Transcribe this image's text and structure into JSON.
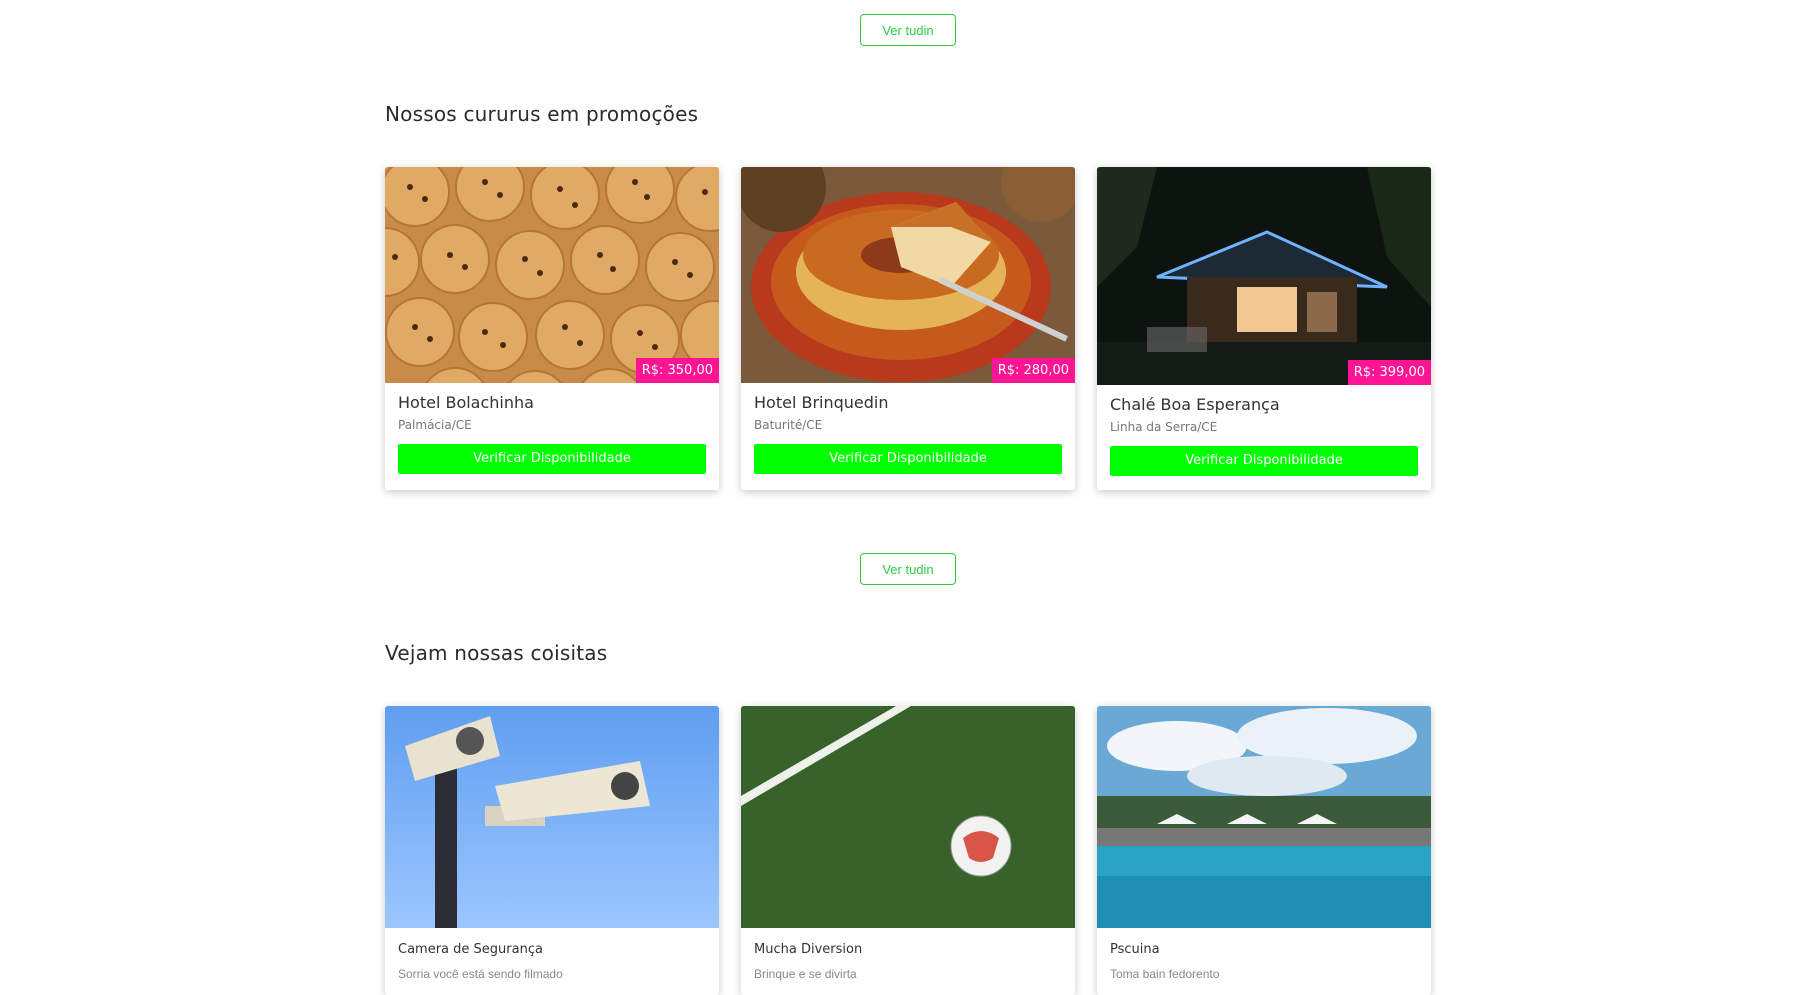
{
  "see_more_label": "Ver tudin",
  "promo_section": {
    "title": "Nossos cururus em promoções",
    "cards": [
      {
        "name": "Hotel Bolachinha",
        "location": "Palmácia/CE",
        "price": "R$: 350,00",
        "button": "Verificar Disponibilidade"
      },
      {
        "name": "Hotel Brinquedin",
        "location": "Baturité/CE",
        "price": "R$: 280,00",
        "button": "Verificar Disponibilidade"
      },
      {
        "name": "Chalé Boa Esperança",
        "location": "Linha da Serra/CE",
        "price": "R$: 399,00",
        "button": "Verificar Disponibilidade"
      }
    ]
  },
  "things_section": {
    "title": "Vejam nossas coisitas",
    "cards": [
      {
        "name": "Camera de Segurança",
        "desc": "Sorria você está sendo filmado"
      },
      {
        "name": "Mucha Diversion",
        "desc": "Brinque e se divirta"
      },
      {
        "name": "Pscuina",
        "desc": "Toma bain fedorento"
      }
    ]
  },
  "colors": {
    "accent_green": "#00ff00",
    "outline_green": "#2ecc40",
    "price_pink": "#ff1493"
  }
}
